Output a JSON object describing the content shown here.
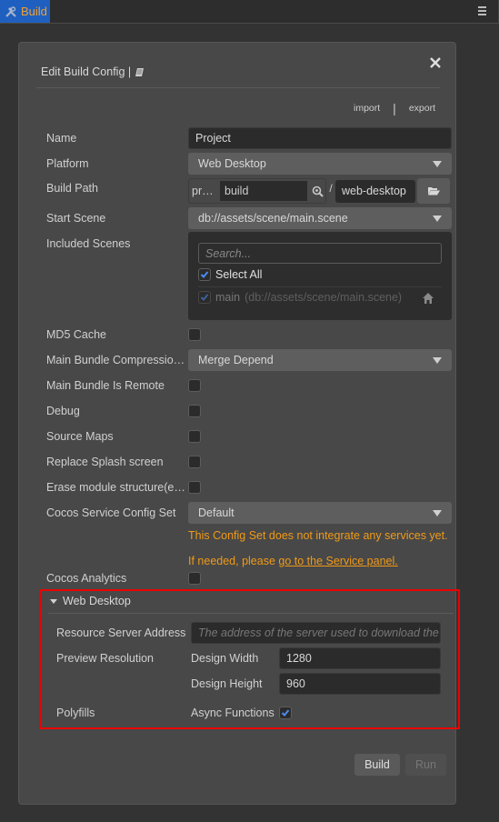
{
  "tab": {
    "label": "Build",
    "icon": "tools-icon"
  },
  "window": {
    "menu_icon": "hamburger-menu-icon"
  },
  "dialog": {
    "title": "Edit Build Config |",
    "doc_icon": "book-icon",
    "close_icon": "close-icon",
    "import_label": "import",
    "separator": "|",
    "export_label": "export"
  },
  "form": {
    "name": {
      "label": "Name",
      "value": "Project"
    },
    "platform": {
      "label": "Platform",
      "value": "Web Desktop"
    },
    "build_path": {
      "label": "Build Path",
      "prefix": "pr…",
      "value": "build",
      "slash": "/",
      "dir": "web-desktop"
    },
    "start_scene": {
      "label": "Start Scene",
      "value": "db://assets/scene/main.scene"
    },
    "included_scenes": {
      "label": "Included Scenes",
      "search_placeholder": "Search...",
      "select_all_label": "Select All",
      "select_all_checked": true,
      "items": [
        {
          "name": "main",
          "path": "(db://assets/scene/main.scene)",
          "checked": true,
          "is_start": true
        }
      ]
    },
    "md5_cache": {
      "label": "MD5 Cache",
      "checked": false
    },
    "main_bundle_compression": {
      "label": "Main Bundle Compressio…",
      "value": "Merge Depend"
    },
    "main_bundle_is_remote": {
      "label": "Main Bundle Is Remote",
      "checked": false
    },
    "debug": {
      "label": "Debug",
      "checked": false
    },
    "source_maps": {
      "label": "Source Maps",
      "checked": false
    },
    "replace_splash": {
      "label": "Replace Splash screen",
      "checked": false
    },
    "erase_module": {
      "label": "Erase module structure(e…",
      "checked": false
    },
    "service_config": {
      "label": "Cocos Service Config Set",
      "value": "Default",
      "warning_text": "This Config Set does not integrate any services yet. If needed, please ",
      "warning_link": "go to the Service panel."
    },
    "cocos_analytics": {
      "label": "Cocos Analytics",
      "checked": false
    }
  },
  "web_desktop": {
    "title": "Web Desktop",
    "resource_server": {
      "label": "Resource Server Address",
      "placeholder": "The address of the server used to download the r"
    },
    "preview_resolution": {
      "label": "Preview Resolution",
      "width_label": "Design Width",
      "width_value": "1280",
      "height_label": "Design Height",
      "height_value": "960"
    },
    "polyfills": {
      "label": "Polyfills",
      "async_label": "Async Functions",
      "async_checked": true
    }
  },
  "footer": {
    "build_label": "Build",
    "run_label": "Run"
  },
  "colors": {
    "accent_blue": "#1f5fbf",
    "tab_text": "#f0a030",
    "warning": "#f09a18",
    "highlight_border": "#ee0000",
    "check_blue": "#4a8cf0"
  }
}
